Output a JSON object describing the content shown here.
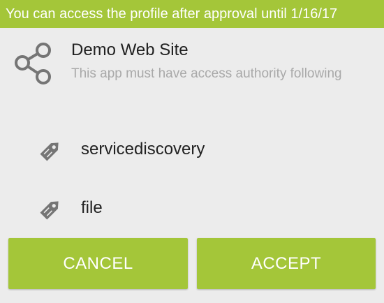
{
  "banner": {
    "text": "You can access the profile after approval until 1/16/17",
    "color": "#a4c639"
  },
  "app": {
    "icon": "share-icon",
    "name": "Demo Web Site",
    "description": "This app must have access authority following"
  },
  "permissions": [
    {
      "icon": "tag-icon",
      "label": "servicediscovery"
    },
    {
      "icon": "tag-icon",
      "label": "file"
    }
  ],
  "buttons": {
    "cancel_label": "CANCEL",
    "accept_label": "ACCEPT",
    "color": "#a4c639"
  }
}
